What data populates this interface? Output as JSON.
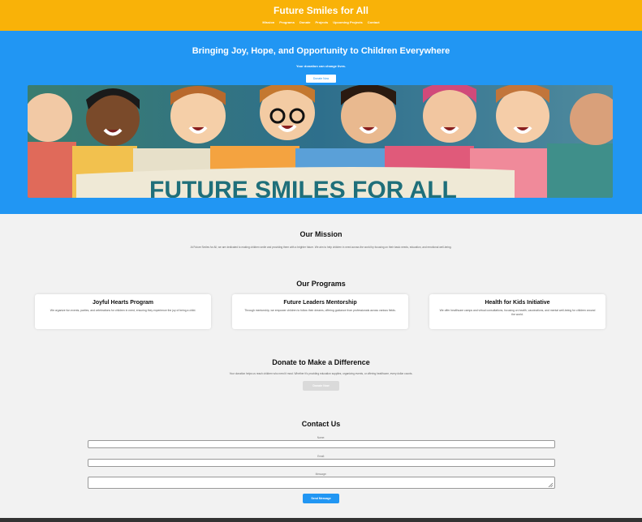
{
  "header": {
    "title": "Future Smiles for All",
    "nav": [
      "Mission",
      "Programs",
      "Donate",
      "Projects",
      "Upcoming Projects",
      "Contact"
    ]
  },
  "hero": {
    "title": "Bringing Joy, Hope, and Opportunity to Children Everywhere",
    "subtitle": "Your donation can change lives.",
    "button": "Donate Now",
    "banner_text": "FUTURE SMILES FOR ALL"
  },
  "mission": {
    "title": "Our Mission",
    "text": "At Future Smiles for All, we are dedicated to making children smile and providing them with a brighter future. We aim to help children in need across the world by focusing on their basic needs, education, and emotional well-being."
  },
  "programs": {
    "title": "Our Programs",
    "cards": [
      {
        "title": "Joyful Hearts Program",
        "text": "We organize fun events, parties, and celebrations for children in need, ensuring they experience the joy of being a child."
      },
      {
        "title": "Future Leaders Mentorship",
        "text": "Through mentorship, we empower children to follow their dreams, offering guidance from professionals across various fields."
      },
      {
        "title": "Health for Kids Initiative",
        "text": "We offer healthcare camps and virtual consultations, focusing on health, vaccinations, and mental well-being for children around the world."
      }
    ]
  },
  "donate": {
    "title": "Donate to Make a Difference",
    "text": "Your donation helps us reach children who need it most. Whether it's providing education supplies, organizing events, or offering healthcare, every dollar counts.",
    "button": "Donate Now"
  },
  "contact": {
    "title": "Contact Us",
    "name_label": "Name:",
    "email_label": "Email:",
    "message_label": "Message:",
    "button": "Send Message"
  },
  "colors": {
    "header": "#f9b208",
    "hero": "#2196f3",
    "background": "#f2f2f2",
    "footer": "#333333"
  }
}
